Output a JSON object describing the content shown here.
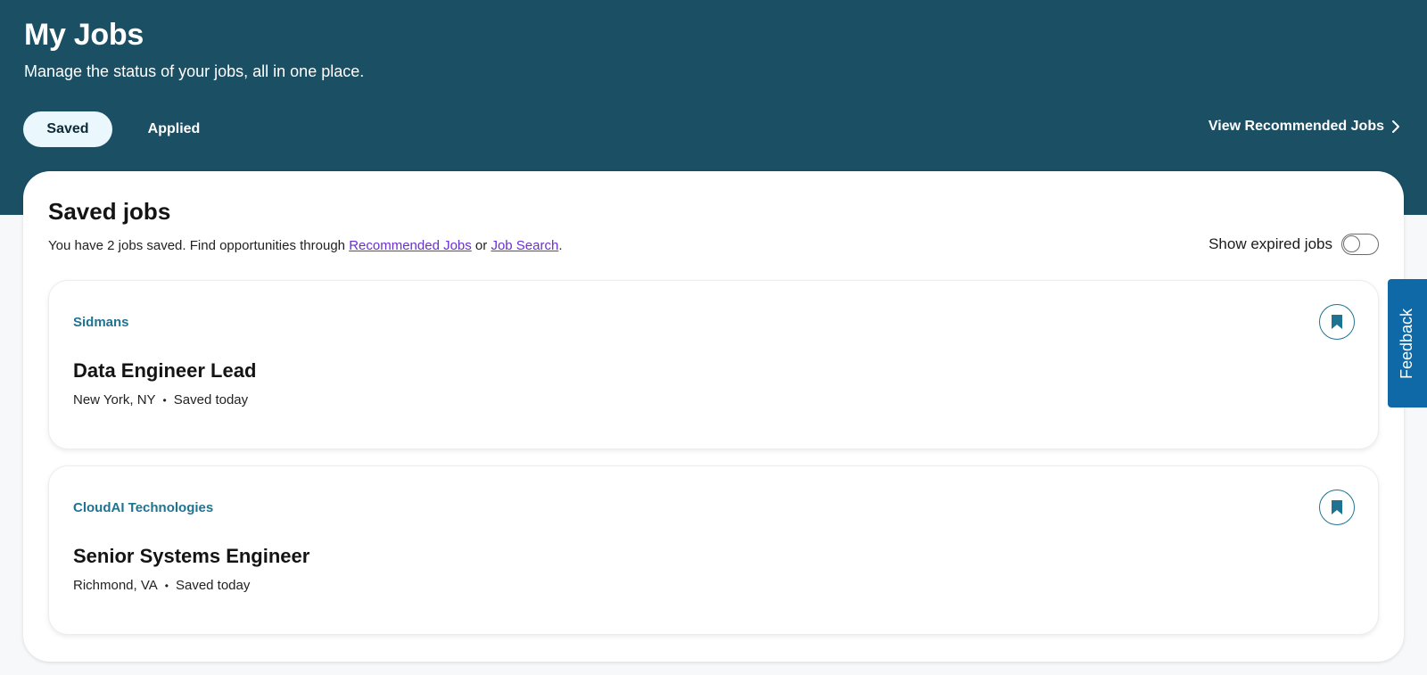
{
  "header": {
    "title": "My Jobs",
    "subtitle": "Manage the status of your jobs, all in one place.",
    "tabs": [
      {
        "label": "Saved",
        "active": true
      },
      {
        "label": "Applied",
        "active": false
      }
    ],
    "recommended_link": "View Recommended Jobs"
  },
  "saved": {
    "title": "Saved jobs",
    "desc_prefix": "You have 2 jobs saved. Find opportunities through ",
    "link_recommended": "Recommended Jobs",
    "desc_or": " or ",
    "link_search": "Job Search",
    "desc_suffix": ".",
    "toggle_label": "Show expired jobs",
    "toggle_on": false
  },
  "jobs": [
    {
      "company": "Sidmans",
      "title": "Data Engineer Lead",
      "location": "New York, NY",
      "saved": "Saved today"
    },
    {
      "company": "CloudAI Technologies",
      "title": "Senior Systems Engineer",
      "location": "Richmond, VA",
      "saved": "Saved today"
    }
  ],
  "feedback": {
    "label": "Feedback"
  },
  "colors": {
    "header_bg": "#1a4f64",
    "accent": "#1f7391",
    "link": "#6a2fd2",
    "feedback_bg": "#0e69a6"
  },
  "icons": {
    "chevron": "chevron-right-icon",
    "bookmark": "bookmark-icon"
  }
}
